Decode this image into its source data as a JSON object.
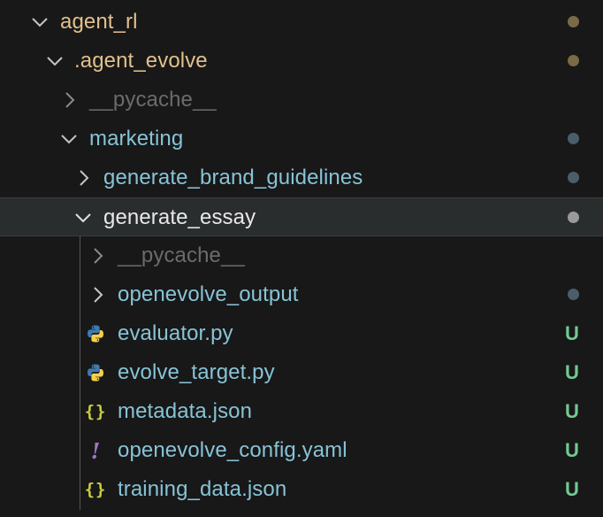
{
  "colors": {
    "background": "#181818",
    "folder_yellow": "#e2c08d",
    "folder_blue": "#87c3d6",
    "dim_gray": "#6b6b6b",
    "selected_white": "#e8e8e8",
    "untracked_green": "#73c991",
    "dot_yellow": "#7a6a46",
    "dot_blue": "#4a5e69",
    "dot_gray": "#9a9a9a",
    "python_blue": "#3d7ab0",
    "python_yellow": "#f5d04a",
    "json_yellow": "#cbcb41",
    "yaml_purple": "#a074c4"
  },
  "tree": {
    "items": [
      {
        "name": "agent_rl",
        "expanded": true,
        "decoration": "modified-dot-yellow"
      },
      {
        "name": ".agent_evolve",
        "expanded": true,
        "decoration": "modified-dot-yellow"
      },
      {
        "name": "__pycache__",
        "expanded": false,
        "ignored": true
      },
      {
        "name": "marketing",
        "expanded": true,
        "decoration": "modified-dot-blue"
      },
      {
        "name": "generate_brand_guidelines",
        "expanded": false,
        "decoration": "modified-dot-blue"
      },
      {
        "name": "generate_essay",
        "expanded": true,
        "selected": true,
        "decoration": "modified-dot-gray"
      },
      {
        "name": "__pycache__",
        "expanded": false,
        "ignored": true
      },
      {
        "name": "openevolve_output",
        "expanded": false,
        "decoration": "modified-dot-blue"
      },
      {
        "name": "evaluator.py",
        "icon": "python-icon",
        "badge": "U"
      },
      {
        "name": "evolve_target.py",
        "icon": "python-icon",
        "badge": "U"
      },
      {
        "name": "metadata.json",
        "icon": "json-braces-icon",
        "badge": "U"
      },
      {
        "name": "openevolve_config.yaml",
        "icon": "yaml-exclamation-icon",
        "badge": "U"
      },
      {
        "name": "training_data.json",
        "icon": "json-braces-icon",
        "badge": "U"
      }
    ]
  },
  "icons": {
    "json_glyph": "{}",
    "yaml_glyph": "!"
  }
}
